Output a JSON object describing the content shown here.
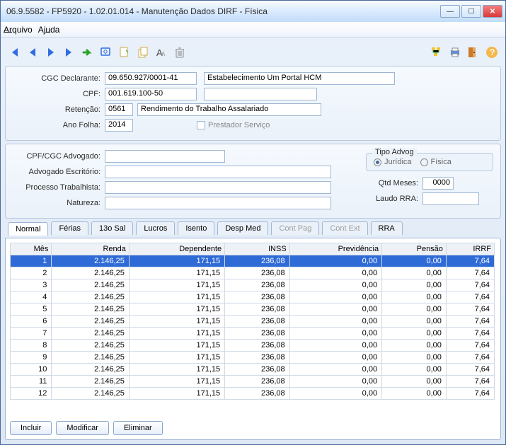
{
  "window": {
    "title": "06.9.5582 - FP5920 - 1.02.01.014 - Manutenção Dados DIRF - Física"
  },
  "menubar": {
    "arquivo": "Arquivo",
    "ajuda": "Ajuda"
  },
  "toolbar_icons": {
    "first": "first-record-icon",
    "prev": "prev-record-icon",
    "next": "next-record-icon",
    "last": "last-record-icon",
    "go": "go-icon",
    "search": "search-icon",
    "new": "new-icon",
    "copy": "copy-icon",
    "text": "text-mode-icon",
    "delete": "delete-icon",
    "tree": "tree-icon",
    "print": "print-icon",
    "exit": "exit-icon",
    "help": "help-icon"
  },
  "form": {
    "labels": {
      "cgc_declarante": "CGC Declarante:",
      "cpf": "CPF:",
      "retencao": "Retenção:",
      "ano_folha": "Ano Folha:",
      "prestador": "Prestador Serviço",
      "cpf_advogado": "CPF/CGC Advogado:",
      "advogado_escritorio": "Advogado Escritório:",
      "processo_trabalhista": "Processo Trabalhista:",
      "natureza": "Natureza:",
      "tipo_advog": "Tipo Advog",
      "juridica": "Jurídica",
      "fisica": "Física",
      "qtd_meses": "Qtd Meses:",
      "laudo_rra": "Laudo RRA:"
    },
    "values": {
      "cgc_declarante": "09.650.927/0001-41",
      "estabelecimento": "Estabelecimento Um Portal HCM",
      "cpf": "001.619.100-50",
      "cpf_extra": "",
      "retencao_cod": "0561",
      "retencao_desc": "Rendimento do Trabalho Assalariado",
      "ano_folha": "2014",
      "qtd_meses": "0000",
      "cpf_advogado": "",
      "advogado_escritorio": "",
      "processo_trabalhista": "",
      "natureza": "",
      "laudo_rra": ""
    }
  },
  "tabs": [
    {
      "label": "Normal",
      "active": true,
      "disabled": false
    },
    {
      "label": "Férias",
      "active": false,
      "disabled": false
    },
    {
      "label": "13o Sal",
      "active": false,
      "disabled": false
    },
    {
      "label": "Lucros",
      "active": false,
      "disabled": false
    },
    {
      "label": "Isento",
      "active": false,
      "disabled": false
    },
    {
      "label": "Desp Med",
      "active": false,
      "disabled": false
    },
    {
      "label": "Cont Pag",
      "active": false,
      "disabled": true
    },
    {
      "label": "Cont Ext",
      "active": false,
      "disabled": true
    },
    {
      "label": "RRA",
      "active": false,
      "disabled": false
    }
  ],
  "grid": {
    "headers": [
      "Mês",
      "Renda",
      "Dependente",
      "INSS",
      "Previdência",
      "Pensão",
      "IRRF"
    ],
    "rows": [
      [
        "1",
        "2.146,25",
        "171,15",
        "236,08",
        "0,00",
        "0,00",
        "7,64"
      ],
      [
        "2",
        "2.146,25",
        "171,15",
        "236,08",
        "0,00",
        "0,00",
        "7,64"
      ],
      [
        "3",
        "2.146,25",
        "171,15",
        "236,08",
        "0,00",
        "0,00",
        "7,64"
      ],
      [
        "4",
        "2.146,25",
        "171,15",
        "236,08",
        "0,00",
        "0,00",
        "7,64"
      ],
      [
        "5",
        "2.146,25",
        "171,15",
        "236,08",
        "0,00",
        "0,00",
        "7,64"
      ],
      [
        "6",
        "2.146,25",
        "171,15",
        "236,08",
        "0,00",
        "0,00",
        "7,64"
      ],
      [
        "7",
        "2.146,25",
        "171,15",
        "236,08",
        "0,00",
        "0,00",
        "7,64"
      ],
      [
        "8",
        "2.146,25",
        "171,15",
        "236,08",
        "0,00",
        "0,00",
        "7,64"
      ],
      [
        "9",
        "2.146,25",
        "171,15",
        "236,08",
        "0,00",
        "0,00",
        "7,64"
      ],
      [
        "10",
        "2.146,25",
        "171,15",
        "236,08",
        "0,00",
        "0,00",
        "7,64"
      ],
      [
        "11",
        "2.146,25",
        "171,15",
        "236,08",
        "0,00",
        "0,00",
        "7,64"
      ],
      [
        "12",
        "2.146,25",
        "171,15",
        "236,08",
        "0,00",
        "0,00",
        "7,64"
      ]
    ],
    "selected_index": 0
  },
  "buttons": {
    "incluir": "Incluir",
    "modificar": "Modificar",
    "eliminar": "Eliminar"
  }
}
